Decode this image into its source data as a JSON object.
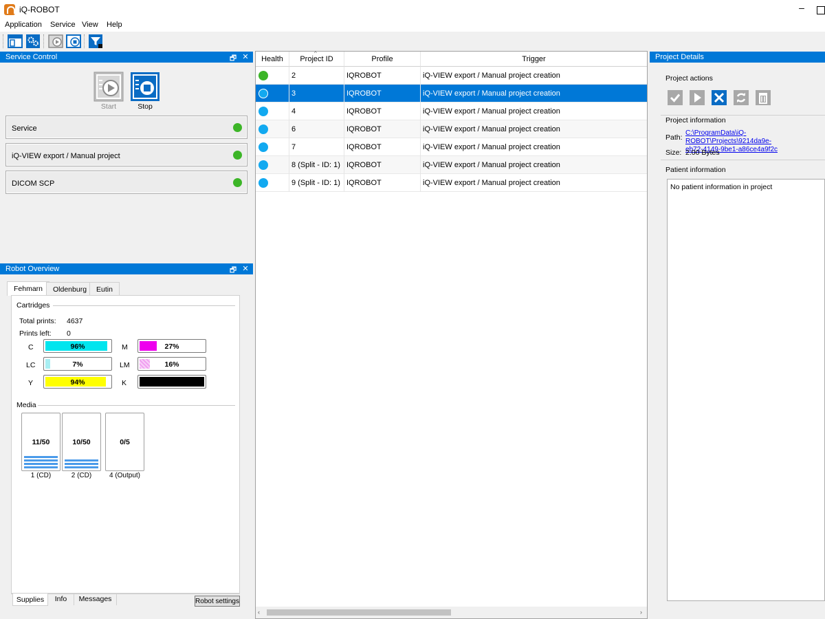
{
  "window": {
    "title": "iQ-ROBOT",
    "minimize": "–"
  },
  "menu": [
    "Application",
    "Service",
    "View",
    "Help"
  ],
  "toolbar": {
    "buttons": [
      "project-window-icon",
      "settings-gears-icon",
      "start-service-icon",
      "stop-service-icon",
      "filter-icon"
    ]
  },
  "service_control": {
    "title": "Service Control",
    "start_label": "Start",
    "stop_label": "Stop",
    "rows": [
      {
        "label": "Service",
        "status_color": "#3cb527"
      },
      {
        "label": "iQ-VIEW export / Manual project",
        "status_color": "#3cb527"
      },
      {
        "label": "DICOM SCP",
        "status_color": "#3cb527"
      }
    ],
    "float_btn": "🗗",
    "close_btn": "✕"
  },
  "robot_overview": {
    "title": "Robot Overview",
    "tabs": [
      "Fehmarn",
      "Oldenburg",
      "Eutin"
    ],
    "active_tab": "Fehmarn",
    "cartridges_title": "Cartridges",
    "total_prints_label": "Total prints:",
    "total_prints": "4637",
    "prints_left_label": "Prints left:",
    "prints_left": "0",
    "cartridges": [
      {
        "code": "C",
        "percent": 96,
        "text": "96%",
        "color": "#00e5ee"
      },
      {
        "code": "M",
        "percent": 27,
        "text": "27%",
        "color": "#ee00ee"
      },
      {
        "code": "LC",
        "percent": 7,
        "text": "7%",
        "color": "#a8eef2"
      },
      {
        "code": "LM",
        "percent": 16,
        "text": "16%",
        "color": "#f0a0f0"
      },
      {
        "code": "Y",
        "percent": 94,
        "text": "94%",
        "color": "#ffff00"
      },
      {
        "code": "K",
        "percent": 100,
        "text": "",
        "color": "#000000"
      }
    ],
    "media_title": "Media",
    "media": [
      {
        "count": "11/50",
        "label": "1 (CD)",
        "fill": 0.22
      },
      {
        "count": "10/50",
        "label": "2 (CD)",
        "fill": 0.2
      },
      {
        "count": "0/5",
        "label": "4 (Output)",
        "fill": 0
      }
    ],
    "bottom_tabs": [
      "Supplies",
      "Info",
      "Messages"
    ],
    "robot_settings_label": "Robot settings"
  },
  "grid": {
    "columns": [
      "Health",
      "Project ID",
      "Profile",
      "Trigger"
    ],
    "rows": [
      {
        "health_color": "#3cb527",
        "id": "2",
        "profile": "IQROBOT",
        "trigger": "iQ-VIEW export / Manual project creation",
        "selected": false
      },
      {
        "health_color": "#12a9f0",
        "id": "3",
        "profile": "IQROBOT",
        "trigger": "iQ-VIEW export / Manual project creation",
        "selected": true
      },
      {
        "health_color": "#12a9f0",
        "id": "4",
        "profile": "IQROBOT",
        "trigger": "iQ-VIEW export / Manual project creation",
        "selected": false
      },
      {
        "health_color": "#12a9f0",
        "id": "6",
        "profile": "IQROBOT",
        "trigger": "iQ-VIEW export / Manual project creation",
        "selected": false
      },
      {
        "health_color": "#12a9f0",
        "id": "7",
        "profile": "IQROBOT",
        "trigger": "iQ-VIEW export / Manual project creation",
        "selected": false
      },
      {
        "health_color": "#12a9f0",
        "id": "8 (Split - ID: 1)",
        "profile": "IQROBOT",
        "trigger": "iQ-VIEW export / Manual project creation",
        "selected": false
      },
      {
        "health_color": "#12a9f0",
        "id": "9 (Split - ID: 1)",
        "profile": "IQROBOT",
        "trigger": "iQ-VIEW export / Manual project creation",
        "selected": false
      }
    ]
  },
  "project_details": {
    "title": "Project Details",
    "actions_title": "Project actions",
    "info_title": "Project information",
    "path_label": "Path:",
    "path_line1": "C:\\ProgramData\\iQ-ROBOT\\Projects\\9214da9e-",
    "path_line2": "eb72-4149-9be1-a86ce4a9f2c",
    "size_label": "Size:",
    "size_value": "2.00 Bytes",
    "patient_title": "Patient information",
    "patient_text": "No patient information in project"
  },
  "colors": {
    "accent": "#0078d7",
    "ok": "#3cb527",
    "pending": "#12a9f0"
  }
}
